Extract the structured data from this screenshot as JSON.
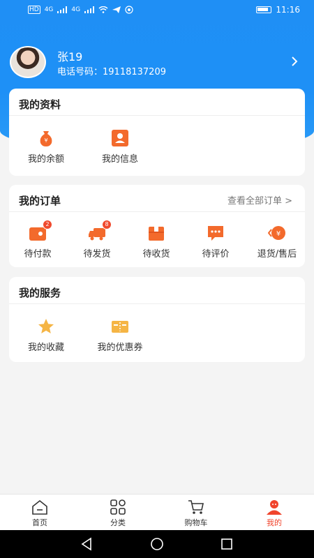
{
  "status_bar": {
    "indicators": [
      "HD",
      "4G",
      "4G"
    ],
    "time": "11:16"
  },
  "profile": {
    "name": "张19",
    "phone_label": "电话号码：",
    "phone": "19118137209"
  },
  "my_info": {
    "title": "我的资料",
    "items": [
      {
        "label": "我的余额",
        "icon": "money-bag-icon"
      },
      {
        "label": "我的信息",
        "icon": "id-card-icon"
      }
    ]
  },
  "my_orders": {
    "title": "我的订单",
    "view_all": "查看全部订单 >",
    "items": [
      {
        "label": "待付款",
        "icon": "wallet-icon",
        "badge": "2"
      },
      {
        "label": "待发货",
        "icon": "truck-icon",
        "badge": "8"
      },
      {
        "label": "待收货",
        "icon": "box-icon",
        "badge": ""
      },
      {
        "label": "待评价",
        "icon": "comment-icon",
        "badge": ""
      },
      {
        "label": "退货/售后",
        "icon": "refund-icon",
        "badge": ""
      }
    ]
  },
  "my_services": {
    "title": "我的服务",
    "items": [
      {
        "label": "我的收藏",
        "icon": "star-icon"
      },
      {
        "label": "我的优惠券",
        "icon": "coupon-icon"
      }
    ]
  },
  "tabbar": {
    "items": [
      {
        "label": "首页",
        "icon": "home-icon"
      },
      {
        "label": "分类",
        "icon": "category-icon"
      },
      {
        "label": "购物车",
        "icon": "cart-icon"
      },
      {
        "label": "我的",
        "icon": "user-icon",
        "active": true
      }
    ]
  },
  "colors": {
    "primary_blue": "#1e90f6",
    "accent_orange": "#f0442c",
    "icon_orange": "#f36a2c",
    "star_yellow": "#f5b545"
  }
}
